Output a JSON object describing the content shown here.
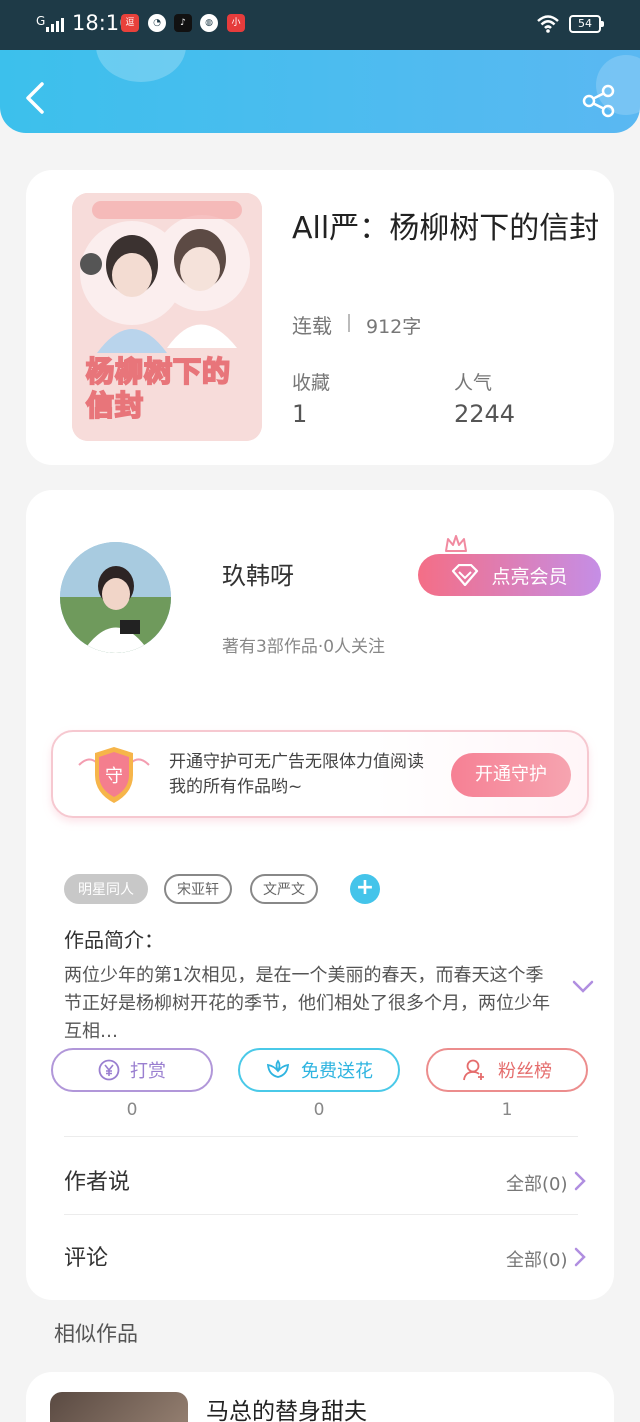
{
  "status_bar": {
    "network": "G",
    "time": "18:16",
    "battery": "54",
    "apps": [
      {
        "icon": "news-app-icon",
        "label": "逗",
        "color": "#e8413b"
      },
      {
        "icon": "speed-app-icon",
        "label": "◔",
        "color": "#ffffff"
      },
      {
        "icon": "tiktok-app-icon",
        "label": "♪",
        "color": "#111111"
      },
      {
        "icon": "browser-app-icon",
        "label": "◍",
        "color": "#ffffff"
      },
      {
        "icon": "video-app-icon",
        "label": "小",
        "color": "#e63c3c"
      }
    ]
  },
  "header": {
    "back_icon": "chevron-left-icon",
    "share_icon": "share-icon",
    "bg_color": "#4cbcf0"
  },
  "book": {
    "title": "All严：杨柳树下的信封",
    "status": "连载",
    "words": "912字",
    "favorites_label": "收藏",
    "favorites_value": "1",
    "popularity_label": "人气",
    "popularity_value": "2244",
    "cover_text": "杨柳树下的信封"
  },
  "author": {
    "name": "玖韩呀",
    "meta": "著有3部作品·0人关注",
    "vip_button": "点亮会员",
    "vip_gradient": [
      "#f46e86",
      "#c58ee6"
    ]
  },
  "guard": {
    "shield_char": "守",
    "line1": "开通守护可无广告无限体力值阅读",
    "line2": "我的所有作品哟~",
    "button": "开通守护"
  },
  "tags": [
    "明星同人",
    "宋亚轩",
    "文严文"
  ],
  "intro": {
    "title": "作品简介：",
    "text": "两位少年的第1次相见，是在一个美丽的春天，而春天这个季节正好是杨柳树开花的季节，他们相处了很多个月，两位少年互相…"
  },
  "actions": [
    {
      "label": "打赏",
      "icon": "yen-coin-icon",
      "count": "0"
    },
    {
      "label": "免费送花",
      "icon": "flower-icon",
      "count": "0"
    },
    {
      "label": "粉丝榜",
      "icon": "user-rank-icon",
      "count": "1"
    }
  ],
  "rows": [
    {
      "label": "作者说",
      "right": "全部(0)"
    },
    {
      "label": "评论",
      "right": "全部(0)"
    }
  ],
  "similar": {
    "title": "相似作品",
    "first_name": "马总的替身甜夫"
  }
}
